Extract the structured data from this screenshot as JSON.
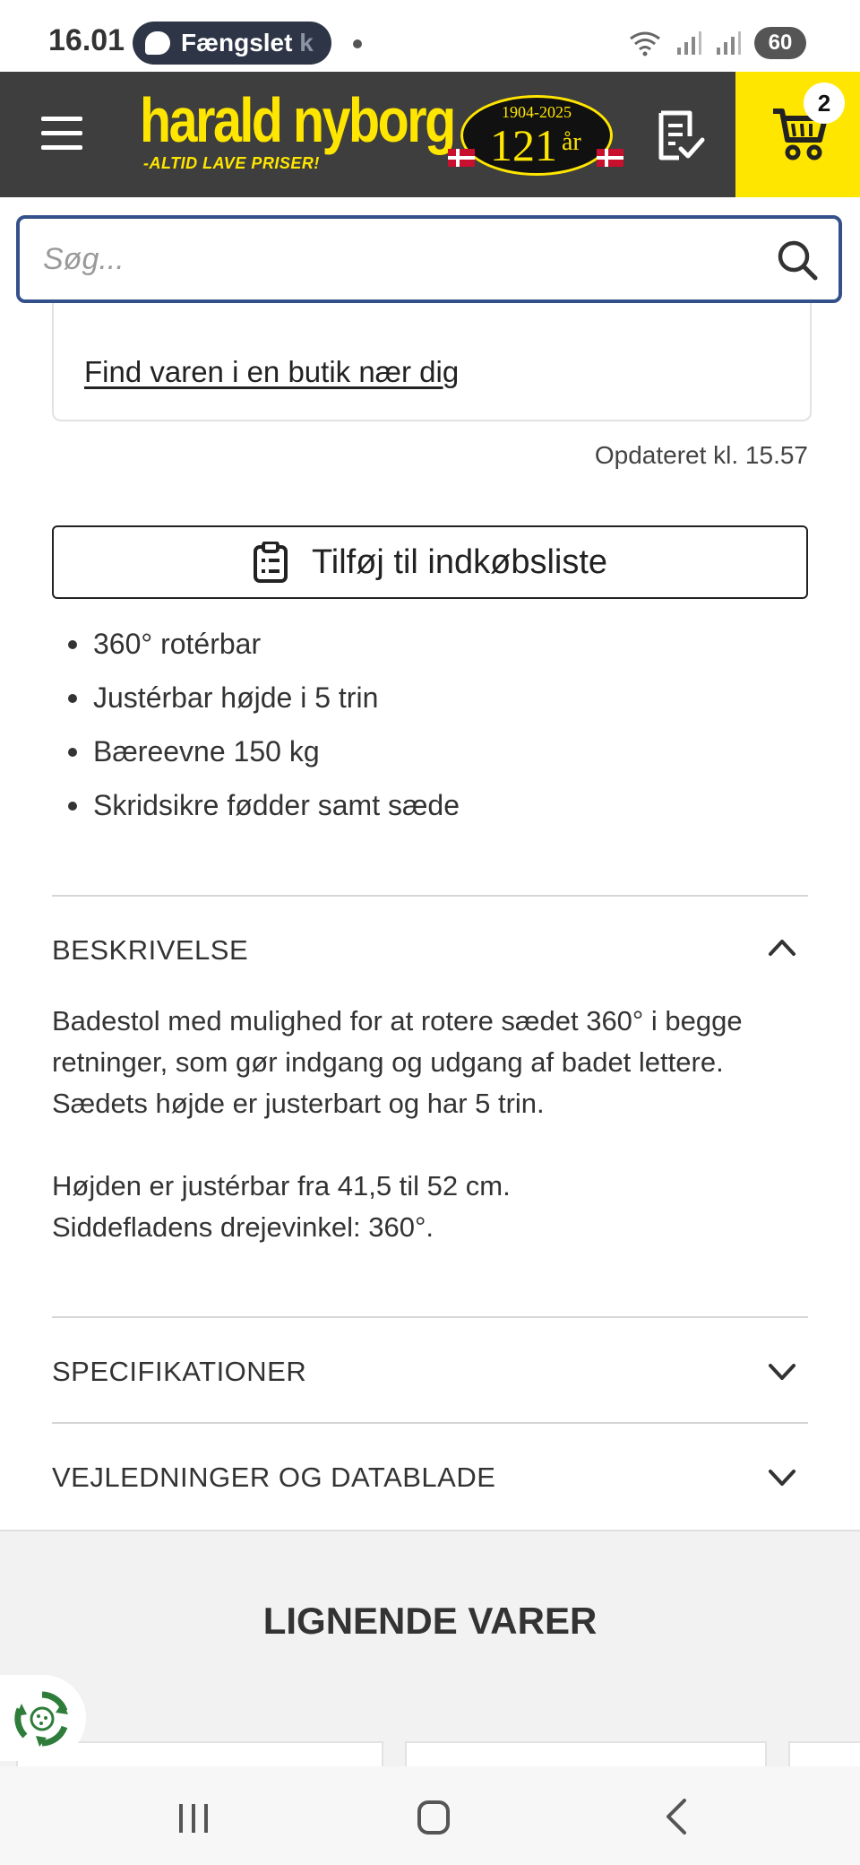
{
  "status_bar": {
    "time": "16.01",
    "notification_label": "Fængslet",
    "notification_trail": "k",
    "battery": "60"
  },
  "header": {
    "logo_name": "harald nyborg",
    "logo_tagline": "-ALTID LAVE PRISER!",
    "logo_years": "1904-2025",
    "logo_anniversary_number": "121",
    "logo_anniversary_unit": "år",
    "cart_count": "2",
    "accent_color": "#ffe600",
    "background_color": "#3e3e3e"
  },
  "search": {
    "placeholder": "Søg..."
  },
  "store": {
    "find_link": "Find varen i en butik nær dig",
    "updated": "Opdateret kl. 15.57"
  },
  "product": {
    "add_to_list_label": "Tilføj til indkøbsliste",
    "features": [
      "360° rotérbar",
      "Justérbar højde i 5 trin",
      "Bæreevne 150 kg",
      "Skridsikre fødder samt sæde"
    ]
  },
  "accordion": {
    "description": {
      "title": "BESKRIVELSE",
      "expanded": true,
      "lines": [
        "Badestol med mulighed for at rotere sædet 360° i begge retninger, som gør indgang og udgang af badet lettere.",
        "Sædets højde er justerbart og har 5 trin.",
        "",
        "Højden er justérbar fra 41,5 til 52 cm.",
        "Siddefladens drejevinkel: 360°."
      ]
    },
    "specifications": {
      "title": "SPECIFIKATIONER",
      "expanded": false
    },
    "guides": {
      "title": "VEJLEDNINGER OG DATABLADE",
      "expanded": false
    }
  },
  "similar": {
    "title": "LIGNENDE VARER"
  },
  "icons": {
    "menu": "menu-icon",
    "shopping_list": "shopping-list-icon",
    "cart": "cart-icon",
    "search": "search-icon",
    "clipboard": "clipboard-icon",
    "chevron_up": "chevron-up-icon",
    "chevron_down": "chevron-down-icon",
    "recycle": "recycle-icon"
  }
}
